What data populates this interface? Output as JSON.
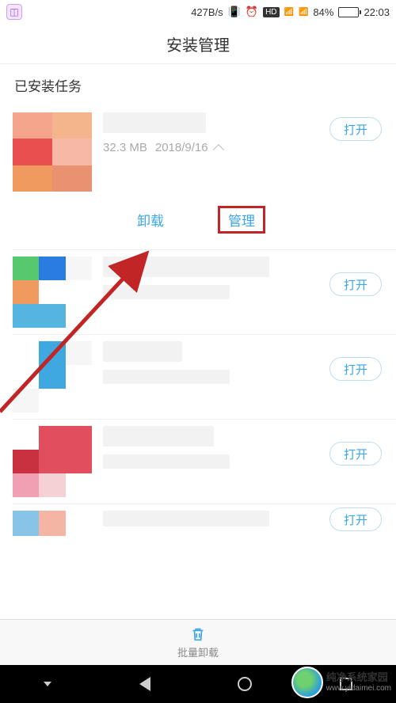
{
  "status": {
    "speed": "427B/s",
    "vibrate": "📳",
    "alarm_icon": "alarm",
    "hd_badge": "HD",
    "net_2g": "2G",
    "net_4g": "4G+4G+",
    "battery_pct": "84%",
    "time": "22:03"
  },
  "page_title": "安装管理",
  "section_header": "已安装任务",
  "apps": [
    {
      "title": "",
      "size": "32.3 MB",
      "date": "2018/9/16",
      "open": "打开",
      "expanded": true
    },
    {
      "title": "",
      "open": "打开"
    },
    {
      "title": "",
      "open": "打开"
    },
    {
      "title": "",
      "open": "打开"
    },
    {
      "title": "",
      "open": "打开"
    }
  ],
  "expanded_actions": {
    "uninstall": "卸载",
    "manage": "管理"
  },
  "toolbar": {
    "batch_uninstall": "批量卸载"
  },
  "watermark": {
    "title": "纯净系统家园",
    "url": "www.yidaimei.com"
  }
}
